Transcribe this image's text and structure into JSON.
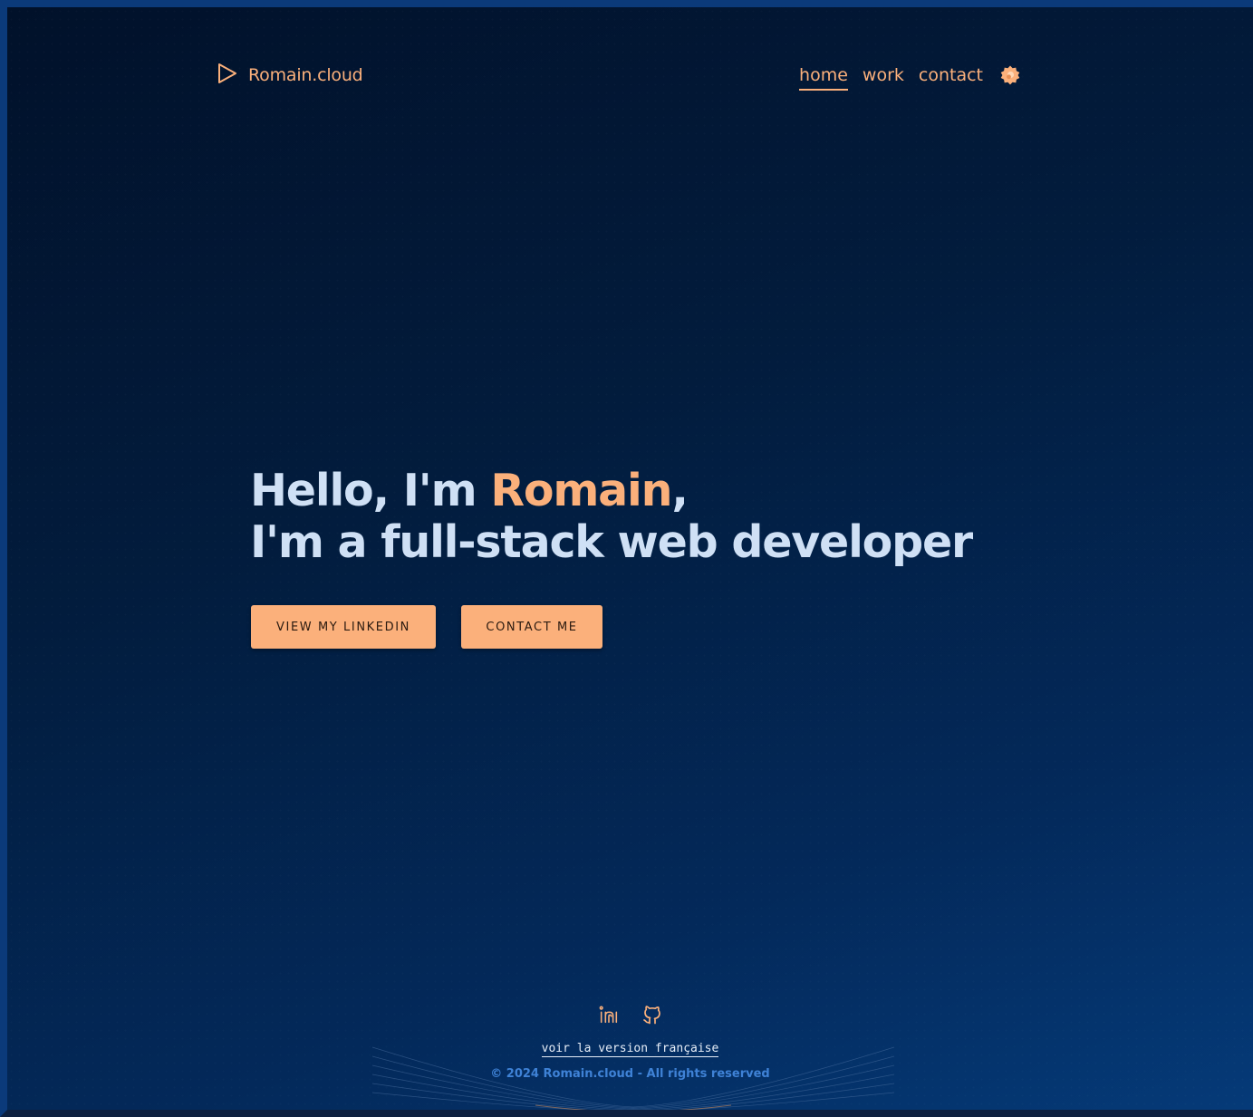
{
  "header": {
    "logo_text": "Romain.cloud",
    "nav": [
      {
        "label": "home",
        "active": true
      },
      {
        "label": "work",
        "active": false
      },
      {
        "label": "contact",
        "active": false
      }
    ],
    "theme_icon": "badge-icon"
  },
  "hero": {
    "line1_prefix": "Hello, I'm ",
    "line1_name": "Romain",
    "line1_suffix": ",",
    "line2": "I'm a full-stack web developer",
    "buttons": {
      "linkedin": "VIEW MY LINKEDIN",
      "contact": "CONTACT ME"
    }
  },
  "footer": {
    "socials": [
      {
        "icon": "linkedin-icon"
      },
      {
        "icon": "github-icon"
      }
    ],
    "language_link": "voir la version française",
    "copyright": "© 2024 Romain.cloud - All rights reserved"
  },
  "colors": {
    "accent": "#fbb07b",
    "heading": "#cfe0f5",
    "copyright": "#3f82d6",
    "bg_dark": "#01112a",
    "bg_light": "#053a78"
  }
}
